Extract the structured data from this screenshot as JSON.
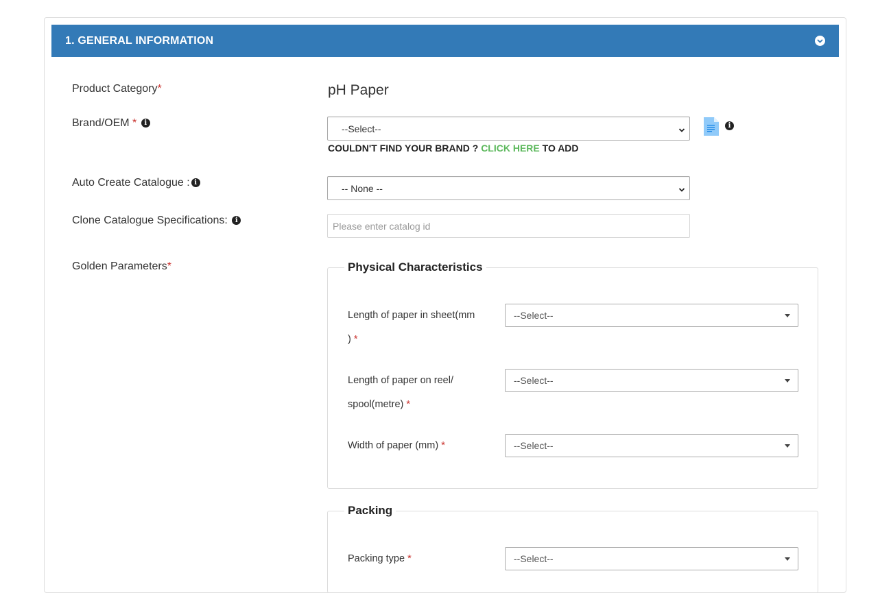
{
  "panel": {
    "title": "1. GENERAL INFORMATION",
    "toggle_icon": "chevron-down-circle-icon",
    "header_color": "#337ab7"
  },
  "product_category": {
    "label": "Product Category",
    "required_mark": "*",
    "value": "pH Paper"
  },
  "brand": {
    "label": "Brand/OEM",
    "required_mark": "*",
    "select_value": "--Select--",
    "note_prefix": "COULDN'T FIND YOUR BRAND ?",
    "note_link": "CLICK HERE",
    "note_suffix": "TO ADD",
    "link_color": "#5cb85c"
  },
  "auto_catalogue": {
    "label": "Auto Create Catalogue :",
    "select_value": "-- None --"
  },
  "clone_catalogue": {
    "label": "Clone Catalogue Specifications:",
    "placeholder": "Please enter catalog id"
  },
  "golden_parameters": {
    "label": "Golden Parameters",
    "required_mark": "*"
  },
  "physical": {
    "legend": "Physical Characteristics",
    "fields": [
      {
        "label_line1": "Length of paper in sheet(mm",
        "label_line2": ")",
        "required_mark": "*",
        "value": "--Select--"
      },
      {
        "label_line1": "Length of paper on reel/",
        "label_line2": "spool(metre)",
        "required_mark": "*",
        "value": "--Select--"
      },
      {
        "label_line1": "Width of paper (mm)",
        "required_mark": "*",
        "value": "--Select--"
      }
    ]
  },
  "packing": {
    "legend": "Packing",
    "fields": [
      {
        "label_line1": "Packing type",
        "required_mark": "*",
        "value": "--Select--"
      }
    ]
  },
  "required_color": "#c9302c"
}
